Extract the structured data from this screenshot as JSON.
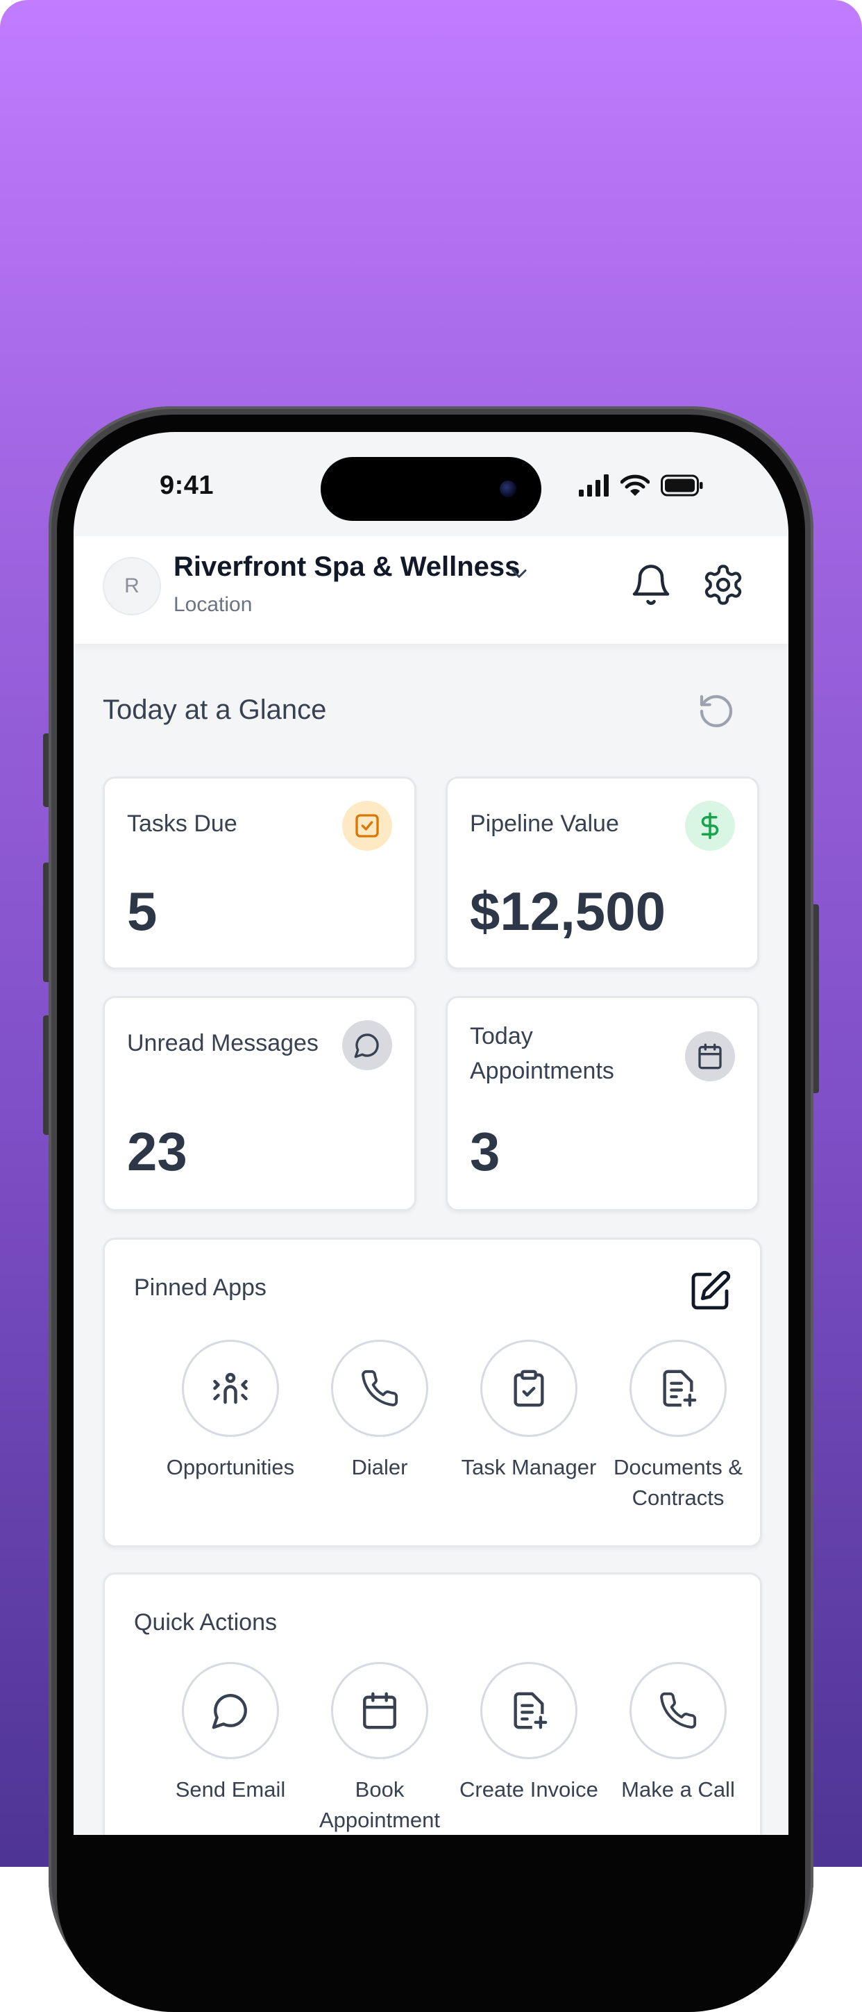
{
  "status_bar": {
    "time": "9:41"
  },
  "header": {
    "avatar_initial": "R",
    "business_name": "Riverfront Spa & Wellness",
    "subtitle": "Location"
  },
  "glance": {
    "title": "Today at a Glance",
    "cards": [
      {
        "label": "Tasks Due",
        "value": "5",
        "icon": "checkbox-icon",
        "icon_bg": "#fde9c3",
        "icon_color": "#d97706"
      },
      {
        "label": "Pipeline Value",
        "value": "$12,500",
        "icon": "dollar-icon",
        "icon_bg": "#d9f5e4",
        "icon_color": "#16a34a"
      },
      {
        "label": "Unread Messages",
        "value": "23",
        "icon": "chat-icon",
        "icon_bg": "#d8dae0",
        "icon_color": "#374151"
      },
      {
        "label": "Today Appointments",
        "value": "3",
        "icon": "calendar-icon",
        "icon_bg": "#d8dae0",
        "icon_color": "#374151"
      }
    ]
  },
  "pinned_apps": {
    "title": "Pinned Apps",
    "items": [
      {
        "label": "Opportunities",
        "icon": "opportunities-icon"
      },
      {
        "label": "Dialer",
        "icon": "phone-icon"
      },
      {
        "label": "Task Manager",
        "icon": "clipboard-check-icon"
      },
      {
        "label": "Documents & Contracts",
        "icon": "document-plus-icon"
      }
    ]
  },
  "quick_actions": {
    "title": "Quick Actions",
    "items": [
      {
        "label": "Send Email",
        "icon": "chat-icon"
      },
      {
        "label": "Book Appointment",
        "icon": "calendar-icon"
      },
      {
        "label": "Create Invoice",
        "icon": "invoice-icon"
      },
      {
        "label": "Make a Call",
        "icon": "phone-icon"
      }
    ]
  },
  "colors": {
    "gradient_top": "#c17cff",
    "gradient_bottom": "#4e3494",
    "text_primary": "#111827",
    "text_secondary": "#374151"
  }
}
